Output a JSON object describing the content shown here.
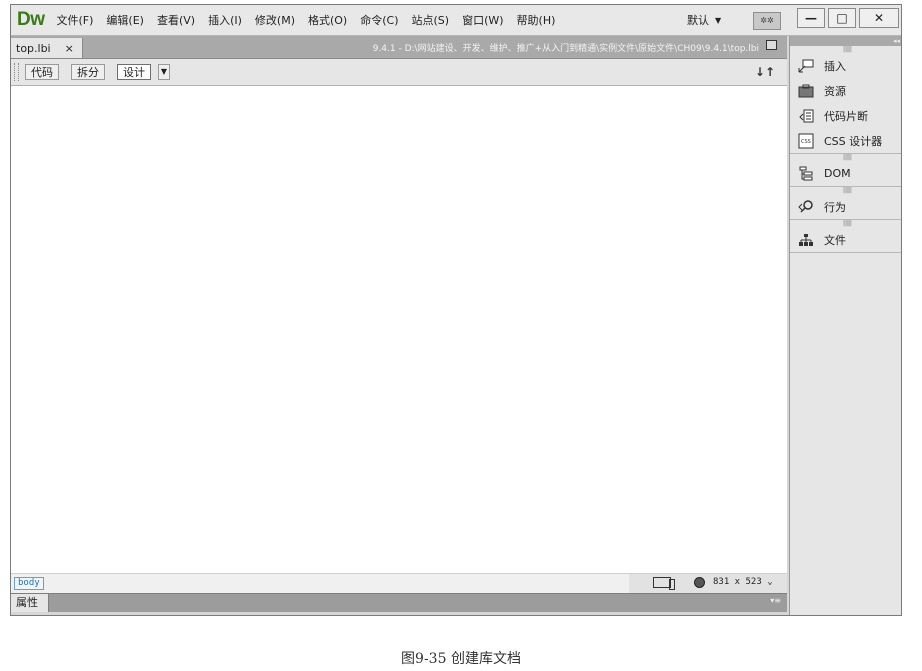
{
  "app": {
    "logo": "Dw",
    "menu": [
      "文件(F)",
      "编辑(E)",
      "查看(V)",
      "插入(I)",
      "修改(M)",
      "格式(O)",
      "命令(C)",
      "站点(S)",
      "窗口(W)",
      "帮助(H)"
    ],
    "layout": "默认",
    "window_controls": {
      "minimize": "—",
      "maximize": "□",
      "close": "✕"
    }
  },
  "document": {
    "tab_label": "top.lbi",
    "tab_close": "×",
    "path": "9.4.1 - D:\\网站建设、开发、维护、推广+从入门到精通\\实例文件\\原始文件\\CH09\\9.4.1\\top.lbi",
    "views": {
      "code": "代码",
      "split": "拆分",
      "design": "设计"
    },
    "status": {
      "tag": "body",
      "dimensions": "831 x 523"
    },
    "properties_label": "属性"
  },
  "panel": {
    "items": [
      {
        "label": "插入",
        "icon": "insert-icon"
      },
      {
        "label": "资源",
        "icon": "assets-icon"
      },
      {
        "label": "代码片断",
        "icon": "snippets-icon"
      },
      {
        "label": "CSS 设计器",
        "icon": "css-designer-icon"
      },
      {
        "label": "DOM",
        "icon": "dom-icon"
      },
      {
        "label": "行为",
        "icon": "behaviors-icon"
      },
      {
        "label": "文件",
        "icon": "files-icon"
      }
    ]
  },
  "caption": "图9-35  创建库文档"
}
